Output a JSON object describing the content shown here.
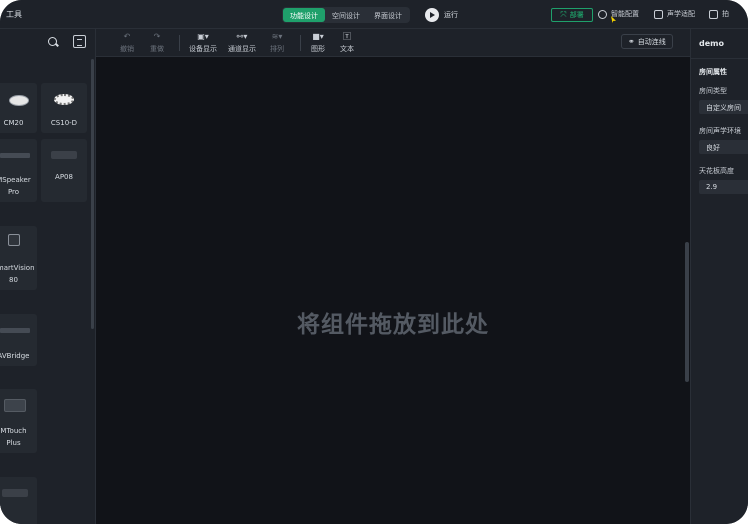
{
  "app": {
    "title": "工具"
  },
  "mode_tabs": [
    {
      "label": "功能设计",
      "active": true
    },
    {
      "label": "空间设计",
      "active": false
    },
    {
      "label": "界面设计",
      "active": false
    }
  ],
  "run": {
    "label": "运行"
  },
  "top_actions": {
    "deploy": "部署",
    "smart_config": "智能配置",
    "acoustic": "声学适配",
    "extra": "拍"
  },
  "toolbar": {
    "undo": "撤销",
    "redo": "重做",
    "device_display": "设备显示",
    "channel_display": "通道显示",
    "arrange": "排列",
    "shape": "图形",
    "text": "文本",
    "auto_wire": "自动连线"
  },
  "devices": [
    {
      "lines": [
        "CM20"
      ],
      "icon": "ceiling-mic-icon"
    },
    {
      "lines": [
        "CS10-D"
      ],
      "icon": "ceiling-speaker-icon"
    },
    {
      "lines": [
        "MSpeaker",
        "Pro"
      ],
      "icon": "soundbar-icon"
    },
    {
      "lines": [
        "AP08"
      ],
      "icon": "amplifier-icon"
    },
    {
      "lines": [
        "SmartVision",
        "80"
      ],
      "icon": "camera-icon"
    },
    {
      "lines": [
        "AVBridge"
      ],
      "icon": "bridge-box-icon"
    },
    {
      "lines": [
        "MTouch",
        "Plus"
      ],
      "icon": "touch-panel-icon"
    }
  ],
  "canvas": {
    "hint": "将组件拖放到此处"
  },
  "properties": {
    "project_name": "demo",
    "section": "房间属性",
    "room_type_label": "房间类型",
    "room_type_value": "自定义房间",
    "acoustic_env_label": "房间声学环境",
    "acoustic_env_value": "良好",
    "ceiling_height_label": "天花板高度",
    "ceiling_height_value": "2.9"
  },
  "colors": {
    "accent": "#1fa06b",
    "background": "#111318",
    "panel": "#1e2229"
  }
}
